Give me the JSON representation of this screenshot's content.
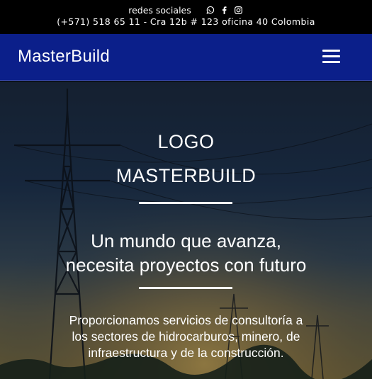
{
  "topbar": {
    "social_label": "redes sociales",
    "social_icons": [
      "whatsapp-icon",
      "facebook-icon",
      "instagram-icon"
    ],
    "contact": "(+571) 518 65 11 - Cra 12b # 123 oficina 40 Colombia"
  },
  "navbar": {
    "brand": "MasterBuild",
    "menu_icon": "hamburger-menu-icon"
  },
  "hero": {
    "logo_line1": "LOGO",
    "logo_line2": "MASTERBUILD",
    "tagline_line1": "Un mundo que avanza,",
    "tagline_line2": "necesita proyectos con futuro",
    "description_line1": "Proporcionamos servicios de consultoría a",
    "description_line2": "los sectores de hidrocarburos, minero, de",
    "description_line3": "infraestructura y de la construcción."
  },
  "colors": {
    "topbar_bg": "#000000",
    "navbar_bg": "#0b1f8a",
    "text": "#ffffff"
  }
}
